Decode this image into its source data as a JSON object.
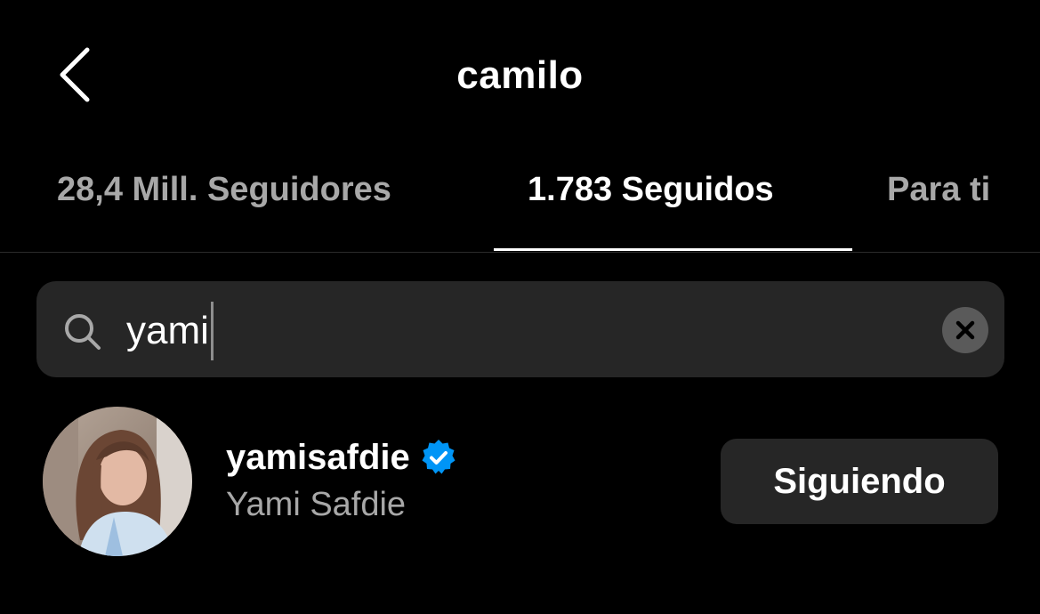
{
  "header": {
    "title": "camilo",
    "back_icon": "chevron-left-icon"
  },
  "tabs": [
    {
      "label": "28,4 Mill. Seguidores",
      "active": false
    },
    {
      "label": "1.783 Seguidos",
      "active": true
    },
    {
      "label": "Para ti",
      "active": false
    }
  ],
  "search": {
    "value": "yami",
    "icon": "search-icon",
    "clear_icon": "clear-x-icon"
  },
  "results": [
    {
      "username": "yamisafdie",
      "verified": true,
      "full_name": "Yami Safdie",
      "button_label": "Siguiendo"
    }
  ],
  "colors": {
    "background": "#000000",
    "text_primary": "#ffffff",
    "text_secondary": "#a8a8a8",
    "surface": "#262626",
    "verified_blue": "#0095f6"
  }
}
